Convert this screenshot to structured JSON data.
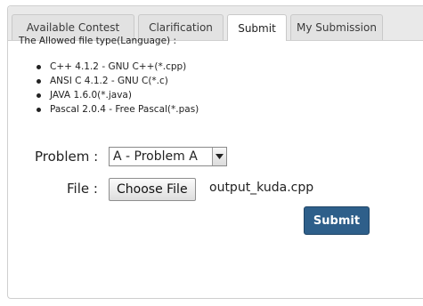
{
  "tabs": [
    {
      "label": "Available Contest"
    },
    {
      "label": "Clarification"
    },
    {
      "label": "Submit"
    },
    {
      "label": "My Submission"
    }
  ],
  "active_tab": "Submit",
  "allowed": {
    "title": "The Allowed file type(Language) :",
    "languages": [
      "C++ 4.1.2 - GNU C++(*.cpp)",
      "ANSI C 4.1.2 - GNU C(*.c)",
      "JAVA 1.6.0(*.java)",
      "Pascal 2.0.4 - Free Pascal(*.pas)"
    ]
  },
  "form": {
    "problem_label": "Problem :",
    "problem_value": "A - Problem A",
    "file_label": "File :",
    "choose_file_label": "Choose File",
    "file_name": "output_kuda.cpp",
    "submit_label": "Submit"
  },
  "colors": {
    "submit_bg": "#2e5f8a",
    "tabbar_bg": "#e9e9e9"
  }
}
